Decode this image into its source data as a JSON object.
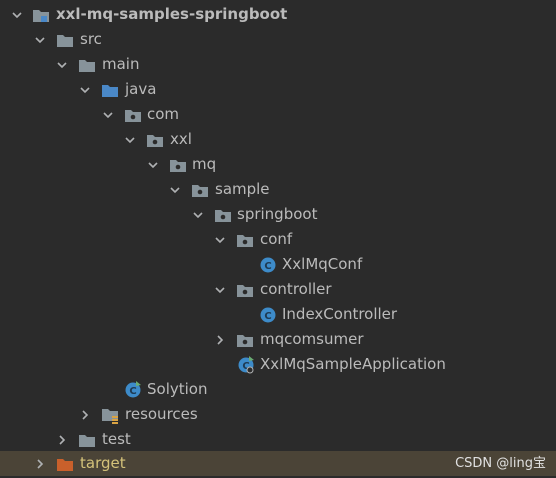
{
  "project": {
    "items": [
      {
        "label": "xxl-mq-samples-springboot",
        "icon": "module-folder-icon",
        "arrow": "expanded"
      },
      {
        "label": "src",
        "icon": "folder-icon",
        "arrow": "expanded"
      },
      {
        "label": "main",
        "icon": "folder-icon",
        "arrow": "expanded"
      },
      {
        "label": "java",
        "icon": "source-folder-icon",
        "arrow": "expanded"
      },
      {
        "label": "com",
        "icon": "package-icon",
        "arrow": "expanded"
      },
      {
        "label": "xxl",
        "icon": "package-icon",
        "arrow": "expanded"
      },
      {
        "label": "mq",
        "icon": "package-icon",
        "arrow": "expanded"
      },
      {
        "label": "sample",
        "icon": "package-icon",
        "arrow": "expanded"
      },
      {
        "label": "springboot",
        "icon": "package-icon",
        "arrow": "expanded"
      },
      {
        "label": "conf",
        "icon": "package-icon",
        "arrow": "expanded"
      },
      {
        "label": "XxlMqConf",
        "icon": "class-icon",
        "arrow": "none"
      },
      {
        "label": "controller",
        "icon": "package-icon",
        "arrow": "expanded"
      },
      {
        "label": "IndexController",
        "icon": "class-icon",
        "arrow": "none"
      },
      {
        "label": "mqcomsumer",
        "icon": "package-icon",
        "arrow": "collapsed"
      },
      {
        "label": "XxlMqSampleApplication",
        "icon": "spring-boot-class-icon",
        "arrow": "none"
      },
      {
        "label": "Solytion",
        "icon": "class-icon",
        "arrow": "none"
      },
      {
        "label": "resources",
        "icon": "resources-folder-icon",
        "arrow": "collapsed"
      },
      {
        "label": "test",
        "icon": "folder-icon",
        "arrow": "collapsed"
      },
      {
        "label": "target",
        "icon": "excluded-folder-icon",
        "arrow": "collapsed"
      }
    ]
  },
  "watermark": "CSDN @ling宝",
  "colors": {
    "background": "#2b2b2b",
    "text": "#bbbbbb",
    "highlight_row": "#4b4437",
    "excluded_text": "#d4c27a",
    "folder": "#87939a",
    "source_folder": "#4a88c7",
    "excluded_folder": "#c9602b",
    "class_icon": "#3d8bc9"
  }
}
